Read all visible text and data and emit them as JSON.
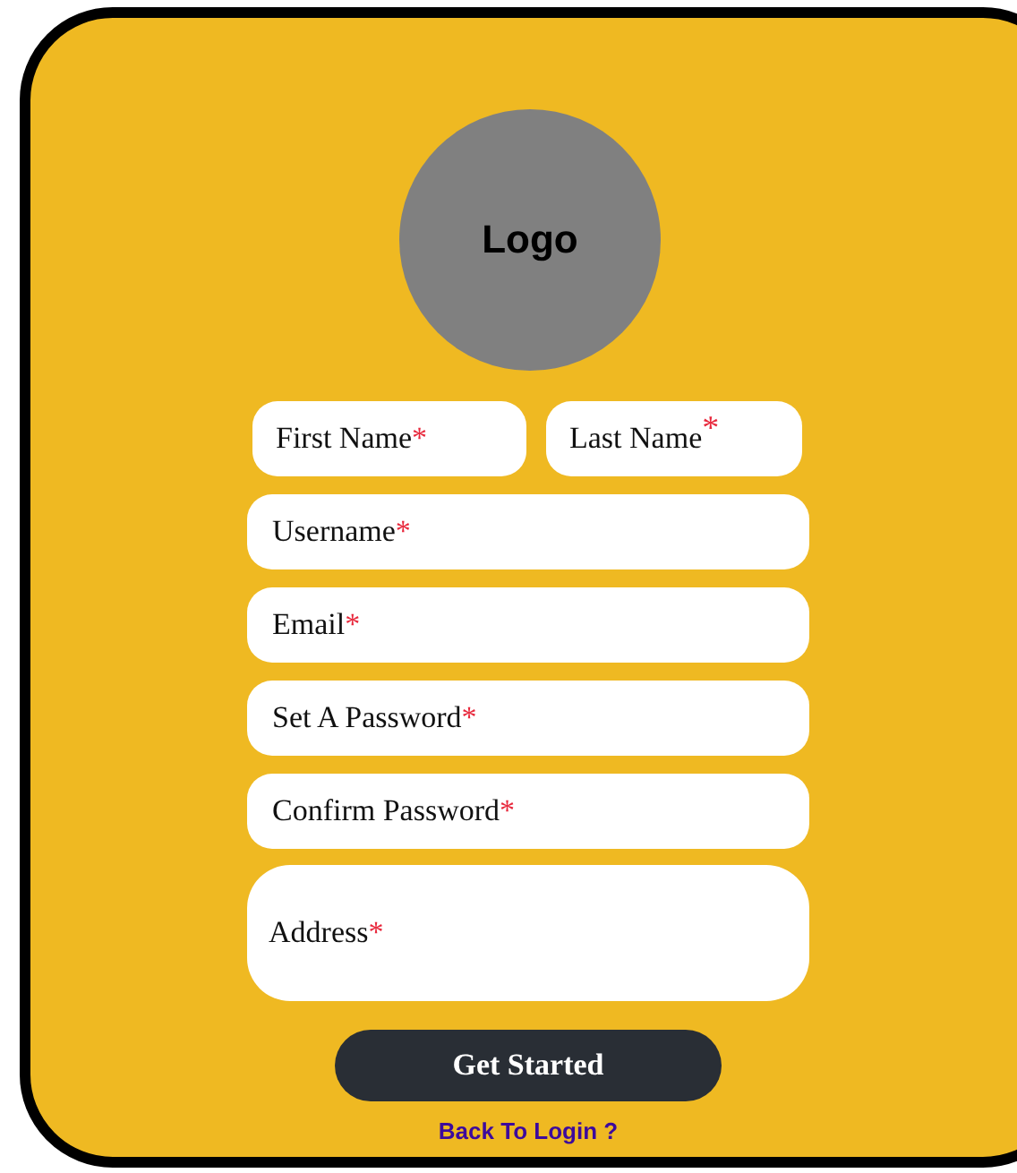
{
  "logo": {
    "text": "Logo"
  },
  "name_row": [
    {
      "label": "First Name",
      "mark": "*"
    },
    {
      "label": "Last Name",
      "mark": "*"
    }
  ],
  "fields": [
    {
      "label": "Username",
      "mark": "*",
      "kind": "line"
    },
    {
      "label": "Email",
      "mark": "*",
      "kind": "line"
    },
    {
      "label": "Set A Password",
      "mark": "*",
      "kind": "line"
    },
    {
      "label": "Confirm Password",
      "mark": "*",
      "kind": "line"
    },
    {
      "label": "Address",
      "mark": "*",
      "kind": "area"
    }
  ],
  "submit": "Get Started",
  "link": "Back To Login ?"
}
